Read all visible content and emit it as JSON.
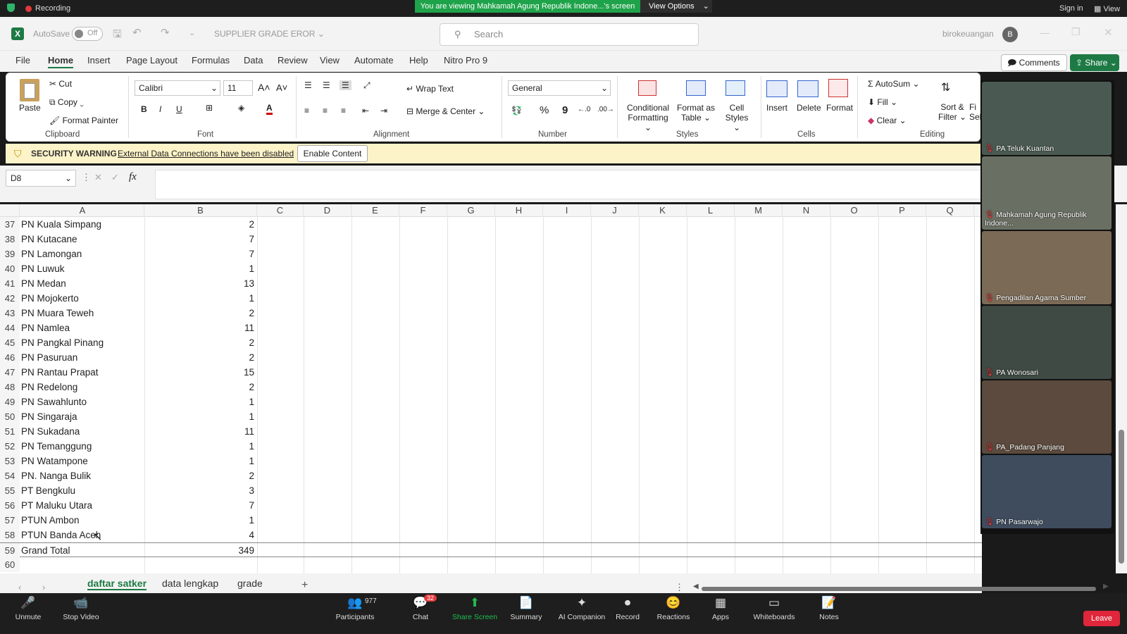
{
  "zoom_top": {
    "recording_label": "Recording",
    "viewing_text": "You are viewing Mahkamah Agung Republik Indone...'s screen",
    "view_options": "View Options",
    "sign_in": "Sign in",
    "view": "View"
  },
  "excel": {
    "autosave_label": "AutoSave",
    "autosave_state": "Off",
    "filename": "SUPPLIER GRADE EROR",
    "search_placeholder": "Search",
    "user": "birokeuangan",
    "user_initial": "B",
    "menu": [
      "File",
      "Home",
      "Insert",
      "Page Layout",
      "Formulas",
      "Data",
      "Review",
      "View",
      "Automate",
      "Help",
      "Nitro Pro 9"
    ],
    "comments": "Comments",
    "share": "Share",
    "ribbon": {
      "paste": "Paste",
      "cut": "Cut",
      "copy": "Copy",
      "format_painter": "Format Painter",
      "clipboard": "Clipboard",
      "font_name": "Calibri",
      "font_size": "11",
      "font_group": "Font",
      "wrap_text": "Wrap Text",
      "merge_center": "Merge & Center",
      "alignment": "Alignment",
      "number_format": "General",
      "number": "Number",
      "conditional": "Conditional",
      "formatting": "Formatting",
      "format_as": "Format as",
      "table": "Table",
      "cell": "Cell",
      "styles_l": "Styles",
      "styles": "Styles",
      "insert": "Insert",
      "delete": "Delete",
      "format": "Format",
      "cells": "Cells",
      "autosum": "AutoSum",
      "fill": "Fill",
      "clear": "Clear",
      "sort": "Sort &",
      "filter": "Filter",
      "fi": "Fi",
      "se": "Sel",
      "editing": "Editing"
    },
    "warning": {
      "title": "SECURITY WARNING",
      "message": "External Data Connections have been disabled",
      "button": "Enable Content"
    },
    "name_box": "D8",
    "fx": "fx",
    "columns": [
      "A",
      "B",
      "C",
      "D",
      "E",
      "F",
      "G",
      "H",
      "I",
      "J",
      "K",
      "L",
      "M",
      "N",
      "O",
      "P",
      "Q"
    ],
    "rows": [
      {
        "n": "37",
        "a": "PN Kuala Simpang",
        "b": "2"
      },
      {
        "n": "38",
        "a": "PN Kutacane",
        "b": "7"
      },
      {
        "n": "39",
        "a": "PN Lamongan",
        "b": "7"
      },
      {
        "n": "40",
        "a": "PN Luwuk",
        "b": "1"
      },
      {
        "n": "41",
        "a": "PN Medan",
        "b": "13"
      },
      {
        "n": "42",
        "a": "PN Mojokerto",
        "b": "1"
      },
      {
        "n": "43",
        "a": "PN Muara Teweh",
        "b": "2"
      },
      {
        "n": "44",
        "a": "PN Namlea",
        "b": "11"
      },
      {
        "n": "45",
        "a": "PN Pangkal Pinang",
        "b": "2"
      },
      {
        "n": "46",
        "a": "PN Pasuruan",
        "b": "2"
      },
      {
        "n": "47",
        "a": "PN Rantau Prapat",
        "b": "15"
      },
      {
        "n": "48",
        "a": "PN Redelong",
        "b": "2"
      },
      {
        "n": "49",
        "a": "PN Sawahlunto",
        "b": "1"
      },
      {
        "n": "50",
        "a": "PN Singaraja",
        "b": "1"
      },
      {
        "n": "51",
        "a": "PN Sukadana",
        "b": "11"
      },
      {
        "n": "52",
        "a": "PN Temanggung",
        "b": "1"
      },
      {
        "n": "53",
        "a": "PN Watampone",
        "b": "1"
      },
      {
        "n": "54",
        "a": "PN. Nanga Bulik",
        "b": "2"
      },
      {
        "n": "55",
        "a": "PT Bengkulu",
        "b": "3"
      },
      {
        "n": "56",
        "a": "PT Maluku Utara",
        "b": "7"
      },
      {
        "n": "57",
        "a": "PTUN Ambon",
        "b": "1"
      },
      {
        "n": "58",
        "a": "PTUN Banda Aceh",
        "b": "4"
      },
      {
        "n": "59",
        "a": "Grand Total",
        "b": "349"
      },
      {
        "n": "60",
        "a": "",
        "b": ""
      }
    ],
    "sheets": [
      "daftar satker",
      "data lengkap",
      "grade"
    ]
  },
  "videos": [
    "PA Teluk Kuantan",
    "Mahkamah Agung Republik Indone...",
    "Pengadilan Agama Sumber",
    "PA Wonosari",
    "PA_Padang Panjang",
    "PN Pasarwajo"
  ],
  "zoom_bottom": {
    "items": [
      "Unmute",
      "Stop Video",
      "Participants",
      "Chat",
      "Share Screen",
      "Summary",
      "AI Companion",
      "Record",
      "Reactions",
      "Apps",
      "Whiteboards",
      "Notes"
    ],
    "participants_count": "977",
    "chat_badge": "32",
    "leave": "Leave"
  }
}
